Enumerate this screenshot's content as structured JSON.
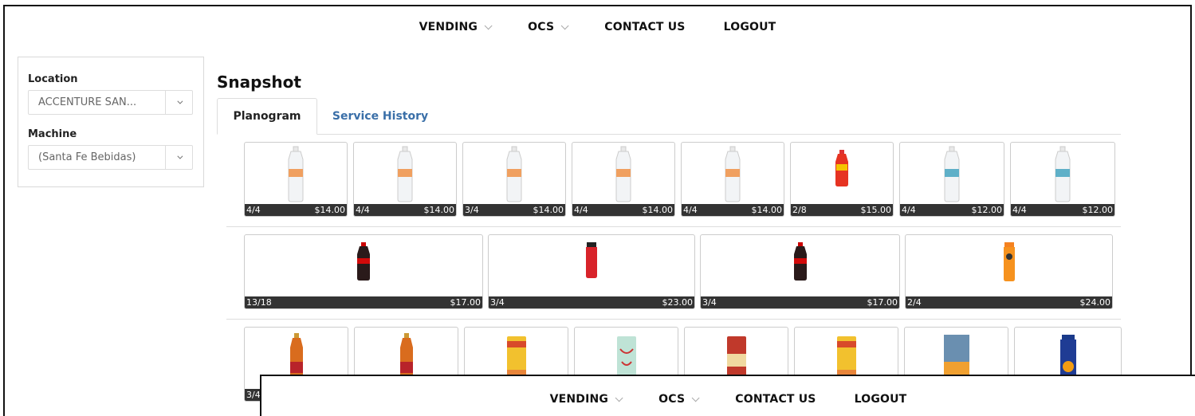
{
  "nav": {
    "items": [
      {
        "label": "VENDING",
        "dropdown": true
      },
      {
        "label": "OCS",
        "dropdown": true
      },
      {
        "label": "CONTACT US",
        "dropdown": false
      },
      {
        "label": "LOGOUT",
        "dropdown": false
      }
    ]
  },
  "filters": {
    "location_label": "Location",
    "location_value": "ACCENTURE SAN...",
    "machine_label": "Machine",
    "machine_value": "(Santa Fe Bebidas)"
  },
  "page": {
    "title": "Snapshot",
    "tabs": [
      {
        "label": "Planogram",
        "active": true
      },
      {
        "label": "Service History",
        "active": false
      }
    ]
  },
  "shelves": [
    {
      "slots": [
        {
          "count": "4/4",
          "price": "$14.00",
          "product": "water-bottle-orange-label-icon"
        },
        {
          "count": "4/4",
          "price": "$14.00",
          "product": "water-bottle-orange-label-icon"
        },
        {
          "count": "3/4",
          "price": "$14.00",
          "product": "water-bottle-orange-label-icon"
        },
        {
          "count": "4/4",
          "price": "$14.00",
          "product": "water-bottle-orange-label-icon"
        },
        {
          "count": "4/4",
          "price": "$14.00",
          "product": "water-bottle-orange-label-icon"
        },
        {
          "count": "2/8",
          "price": "$15.00",
          "product": "red-soda-bottle-icon"
        },
        {
          "count": "4/4",
          "price": "$12.00",
          "product": "water-bottle-blue-label-icon"
        },
        {
          "count": "4/4",
          "price": "$12.00",
          "product": "water-bottle-blue-label-icon"
        }
      ]
    },
    {
      "slots": [
        {
          "count": "13/18",
          "price": "$17.00",
          "product": "cola-bottle-icon"
        },
        {
          "count": "3/4",
          "price": "$23.00",
          "product": "red-sports-drink-icon"
        },
        {
          "count": "3/4",
          "price": "$17.00",
          "product": "cola-bottle-icon"
        },
        {
          "count": "2/4",
          "price": "$24.00",
          "product": "orange-sports-drink-icon"
        }
      ]
    },
    {
      "slots": [
        {
          "count": "3/4",
          "price": "",
          "product": "tea-bottle-icon"
        },
        {
          "count": "",
          "price": "",
          "product": "tea-bottle-icon"
        },
        {
          "count": "",
          "price": "",
          "product": "arizona-mango-can-icon"
        },
        {
          "count": "",
          "price": "",
          "product": "arizona-green-tea-can-icon"
        },
        {
          "count": "",
          "price": "",
          "product": "arizona-red-can-icon"
        },
        {
          "count": "",
          "price": "",
          "product": "arizona-mango-can-icon"
        },
        {
          "count": "",
          "price": "",
          "product": "juice-can-icon"
        },
        {
          "count": "",
          "price": "",
          "product": "jumex-juice-bottle-icon"
        }
      ]
    }
  ],
  "colors": {
    "link": "#3a6fa8",
    "price_bar": "#333333",
    "border": "#cccccc"
  }
}
